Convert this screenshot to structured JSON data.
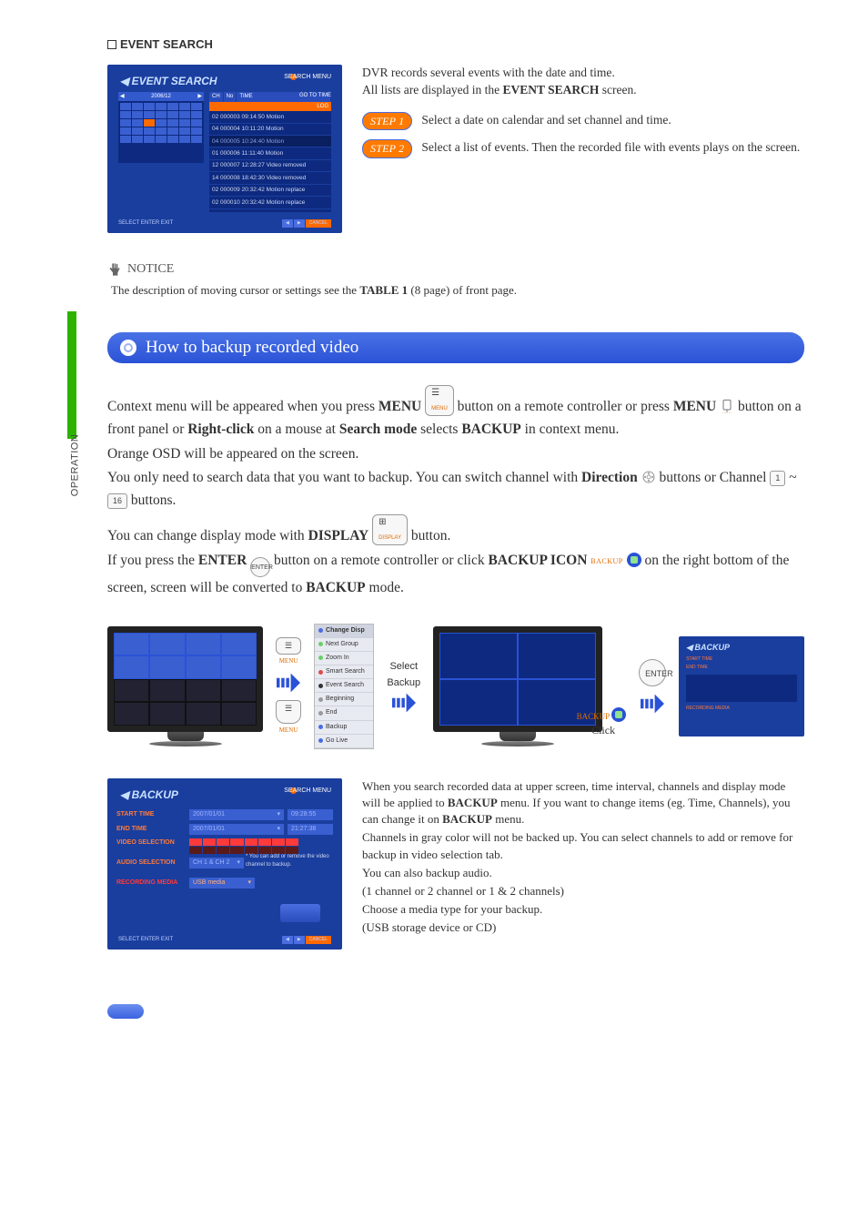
{
  "sideTab": "OPERATION",
  "section1": {
    "title": "EVENT SEARCH",
    "intro1": "DVR records several events with the date and time.",
    "intro2_a": "All lists are displayed in the ",
    "intro2_b": "EVENT SEARCH",
    "intro2_c": " screen.",
    "step1_label": "STEP 1",
    "step1_text": "Select a date on calendar and set channel and time.",
    "step2_label": "STEP 2",
    "step2_text": "Select a list of events. Then the recorded file with events plays on the screen."
  },
  "eventShot": {
    "title": "EVENT SEARCH",
    "menuLabel": "SEARCH MENU",
    "calHeadL": "2006/12",
    "goto": "GO TO TIME",
    "logLabel": "LOG",
    "cols": {
      "ch": "CH",
      "no": "No",
      "time": "TIME"
    },
    "rows": [
      "02  000003  09:14:50   Motion",
      "04  000004  10:11:20   Motion",
      "04  000005  10:24:40   Motion",
      "01  000006  11:11:40   Motion",
      "12  000007  12:28:27   Video removed",
      "14  000008  18:42:30   Video removed",
      "02  000009  20:32:42   Motion replace",
      "02  000010  20:32:42   Motion replace"
    ],
    "footL": "SELECT      ENTER      EXIT",
    "footBtns": [
      "◀",
      "▶",
      "CANCEL"
    ]
  },
  "notice": {
    "head": "NOTICE",
    "text_a": "The description of moving cursor or settings see the ",
    "text_b": "TABLE 1",
    "text_c": " (8 page) of front page."
  },
  "heading2": "How to backup recorded video",
  "body": {
    "p1_a": "Context menu will be appeared when you press ",
    "p1_b": "MENU",
    "p1_c": " button on a remote controller or press ",
    "p1_d": "MENU",
    "p1_e": " button on a front panel or ",
    "p1_f": "Right-click",
    "p1_g": " on a mouse at ",
    "p1_h": "Search mode",
    "p1_i": " selects ",
    "p1_j": "BACKUP",
    "p1_k": " in context menu.",
    "p2": "Orange OSD will be appeared on the screen.",
    "p3_a": "You only need to search data that you want to backup. You can switch channel with ",
    "p3_b": "Direction",
    "p3_c": " buttons or Channel ",
    "p3_d": " ~ ",
    "p3_e": " buttons.",
    "ch1": "1",
    "ch16": "16",
    "p4_a": "You can change display mode with ",
    "p4_b": "DISPLAY",
    "p4_c": " button.",
    "p5_a": "If you press the ",
    "p5_b": "ENTER",
    "p5_c": " button on a remote controller or click ",
    "p5_d": "BACKUP ICON",
    "p5_e": " on the right bottom of the screen, screen will be converted to ",
    "p5_f": "BACKUP",
    "p5_g": " mode.",
    "backup_small": "BACKUP",
    "enter_small": "ENTER",
    "menu_small": "MENU",
    "display_small": "DISPLAY",
    "display_sym": "⊞"
  },
  "flow": {
    "menu_key": "☰",
    "menu_sub": "MENU",
    "selectLabel": "Select",
    "backupLabel": "Backup",
    "enterLabel": "ENTER",
    "clickLabel": "Click",
    "backupChip": "BACKUP",
    "ctx": {
      "hd": "Change Disp",
      "i1": "Next Group",
      "i2": "Zoom In",
      "i3": "Smart Search",
      "i4": "Event Search",
      "i5": "Beginning",
      "i6": "End",
      "i7": "Backup",
      "i8": "Go Live"
    }
  },
  "backupShot": {
    "title": "BACKUP",
    "menuLabel": "SEARCH MENU",
    "rows": {
      "start": "START TIME",
      "startD": "2007/01/01",
      "startT": "09:28:55",
      "end": "END TIME",
      "endD": "2007/01/01",
      "endT": "21:27:38",
      "video": "VIDEO SELECTION",
      "audio": "AUDIO SELECTION",
      "audioV": "CH 1 & CH 2",
      "media": "RECORDING MEDIA",
      "mediaV": "USB media"
    },
    "sideNote": "* You can add or remove the video channel to backup.",
    "footL": "SELECT      ENTER      EXIT",
    "footBtns": [
      "◀",
      "▶",
      "CANCEL"
    ]
  },
  "lower": {
    "p1_a": "When you search recorded data at upper screen, time interval, channels and display mode will be applied to ",
    "p1_b": "BACKUP",
    "p1_c": " menu. If you want to change items (eg. Time, Channels), you can change it on ",
    "p1_d": "BACKUP",
    "p1_e": " menu.",
    "p2": "Channels in gray color will not be backed up. You can select channels to add or remove for backup in video selection tab.",
    "p3": "You can also backup audio.",
    "p4": "(1 channel or 2 channel or 1 & 2 channels)",
    "p5": "Choose a media type for your backup.",
    "p6": "(USB storage device or CD)"
  }
}
